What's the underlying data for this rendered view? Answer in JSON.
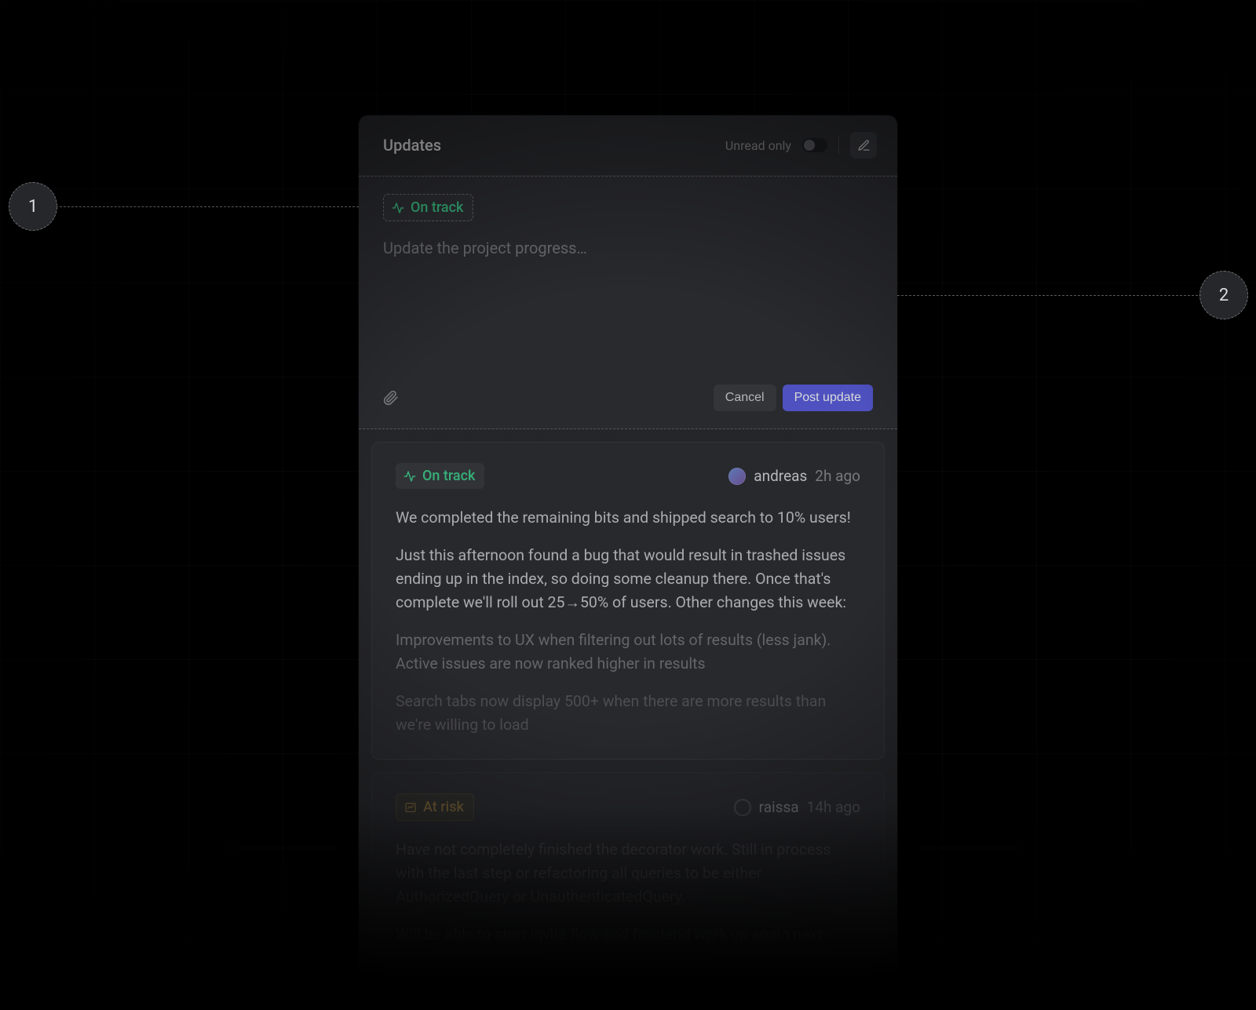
{
  "callouts": {
    "one": "1",
    "two": "2"
  },
  "header": {
    "title": "Updates",
    "unread_label": "Unread only"
  },
  "editor": {
    "status_label": "On track",
    "placeholder": "Update the project progress…",
    "cancel": "Cancel",
    "submit": "Post update"
  },
  "feed": [
    {
      "status": "On track",
      "status_kind": "green",
      "author": "andreas",
      "time": "2h ago",
      "paragraphs": [
        "We completed the remaining bits and shipped search to 10% users!",
        "Just this afternoon found a bug that would result in trashed issues ending up in the index, so doing some cleanup there. Once that's complete we'll roll out 25→50% of users. Other changes this week:",
        "Improvements to UX when filtering out lots of results (less jank). Active issues are now ranked higher in results",
        "Search tabs now display 500+ when there are more results than we're willing to load"
      ]
    },
    {
      "status": "At risk",
      "status_kind": "yellow",
      "author": "raissa",
      "time": "14h ago",
      "paragraphs": [
        "Have not completely finished the decorator work. Still in process with the last step or refactoring all queries to be either AuthorizedQuery or UnauthenticatedQuery.",
        "Will be able to start invite flow and frontend work up again next"
      ]
    }
  ]
}
